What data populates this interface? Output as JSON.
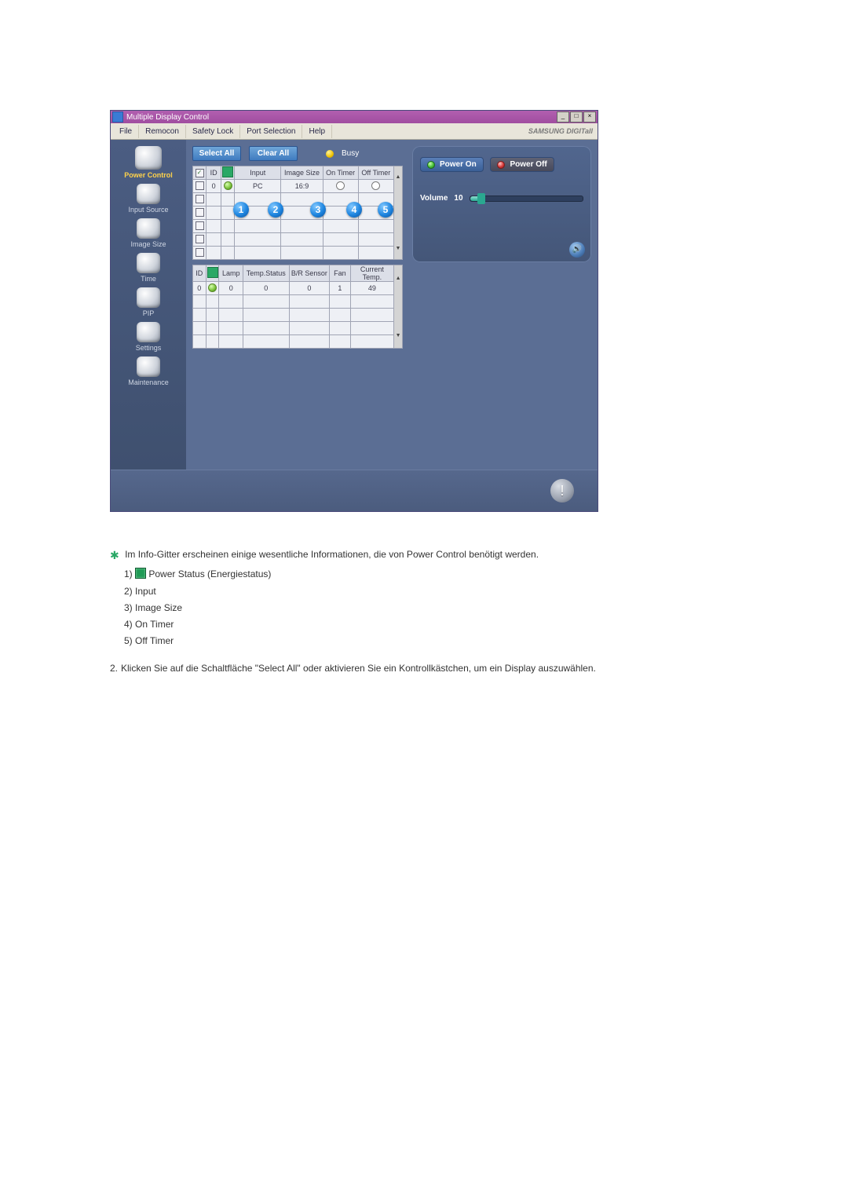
{
  "app": {
    "title": "Multiple Display Control",
    "brand": "SAMSUNG DIGITall",
    "menu": [
      "File",
      "Remocon",
      "Safety Lock",
      "Port Selection",
      "Help"
    ],
    "busy_label": "Busy"
  },
  "sidebar": {
    "items": [
      {
        "label": "Power Control",
        "active": true
      },
      {
        "label": "Input Source"
      },
      {
        "label": "Image Size"
      },
      {
        "label": "Time"
      },
      {
        "label": "PIP"
      },
      {
        "label": "Settings"
      },
      {
        "label": "Maintenance"
      }
    ]
  },
  "toolbar": {
    "select_all": "Select All",
    "clear_all": "Clear All"
  },
  "grid1": {
    "headers": [
      "",
      "ID",
      "",
      "Input",
      "Image Size",
      "On Timer",
      "Off Timer"
    ],
    "rows": [
      {
        "chk": true,
        "id": "0",
        "pwr": "green",
        "input": "PC",
        "size": "16:9",
        "on": "ring",
        "off": "ring"
      },
      {
        "chk": false
      },
      {
        "chk": false
      },
      {
        "chk": false
      },
      {
        "chk": false
      },
      {
        "chk": false
      }
    ]
  },
  "callouts": [
    "1",
    "2",
    "3",
    "4",
    "5"
  ],
  "grid2": {
    "headers": [
      "ID",
      "",
      "Lamp",
      "Temp.Status",
      "B/R Sensor",
      "Fan",
      "Current Temp."
    ],
    "rows": [
      {
        "id": "0",
        "pwr": "green",
        "lamp": "0",
        "temp": "0",
        "br": "0",
        "fan": "1",
        "cur": "49"
      },
      {},
      {},
      {},
      {}
    ]
  },
  "controls": {
    "power_on": "Power On",
    "power_off": "Power Off",
    "volume_label": "Volume",
    "volume_value": "10",
    "volume_pct": 10
  },
  "explain": {
    "intro": "Im Info-Gitter erscheinen einige wesentliche Informationen, die von Power Control benötigt werden.",
    "items": [
      "Power Status (Energiestatus)",
      "Input",
      "Image Size",
      "On Timer",
      "Off Timer"
    ],
    "step2": "Klicken Sie auf die Schaltfläche \"Select All\" oder aktivieren Sie ein Kontrollkästchen, um ein Display auszuwählen."
  }
}
